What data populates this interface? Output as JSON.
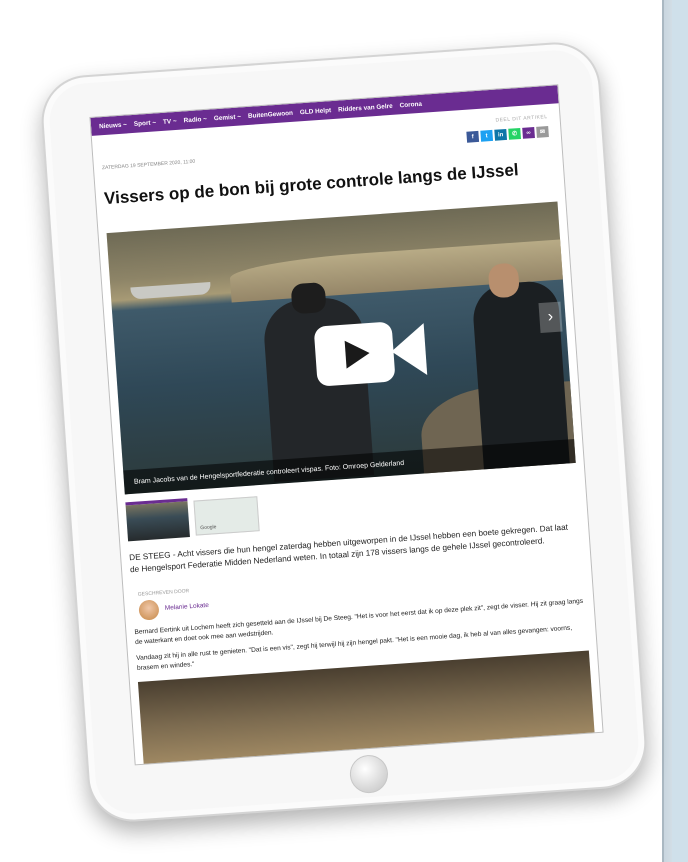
{
  "nav": {
    "items": [
      "Nieuws ~",
      "Sport ~",
      "TV ~",
      "Radio ~",
      "Gemist ~",
      "BuitenGewoon",
      "GLD Helpt",
      "Ridders van Gelre",
      "Corona"
    ],
    "color": "#6a2c91"
  },
  "article": {
    "date": "ZATERDAG 19 SEPTEMBER 2020, 11:00",
    "share_label": "DEEL DIT ARTIKEL",
    "share_buttons": [
      {
        "icon": "f",
        "color": "#3b5998"
      },
      {
        "icon": "t",
        "color": "#1da1f2"
      },
      {
        "icon": "in",
        "color": "#0e76a8"
      },
      {
        "icon": "wa",
        "color": "#25d366"
      },
      {
        "icon": "link",
        "color": "#6a2c91"
      },
      {
        "icon": "mail",
        "color": "#999999"
      }
    ],
    "title": "Vissers op de bon bij grote controle langs de IJssel",
    "caption": "Bram Jacobs van de Hengelsportfederatie controleert vispas. Foto: Omroep Gelderland",
    "map_label": "Google",
    "intro": "DE STEEG - Acht vissers die hun hengel zaterdag hebben uitgeworpen in de IJssel hebben een boete gekregen. Dat laat de Hengelsport Federatie Midden Nederland weten. In totaal zijn 178 vissers langs de gehele IJssel gecontroleerd.",
    "byline_label": "GESCHREVEN DOOR",
    "author": "Melanie Lokate",
    "paragraph1": "Bernard Eertink uit Lochem heeft zich gesetteld aan de IJssel bij De Steeg. \"Het is voor het eerst dat ik op deze plek zit\", zegt de visser. Hij zit graag langs de waterkant en doet ook mee aan wedstrijden.",
    "paragraph2": "Vandaag zit hij in alle rust te genieten. \"Dat is een vis\", zegt hij terwijl hij zijn hengel pakt. \"Het is een mooie dag, ik heb al van alles gevangen: voorns, brasem en windes.\""
  }
}
